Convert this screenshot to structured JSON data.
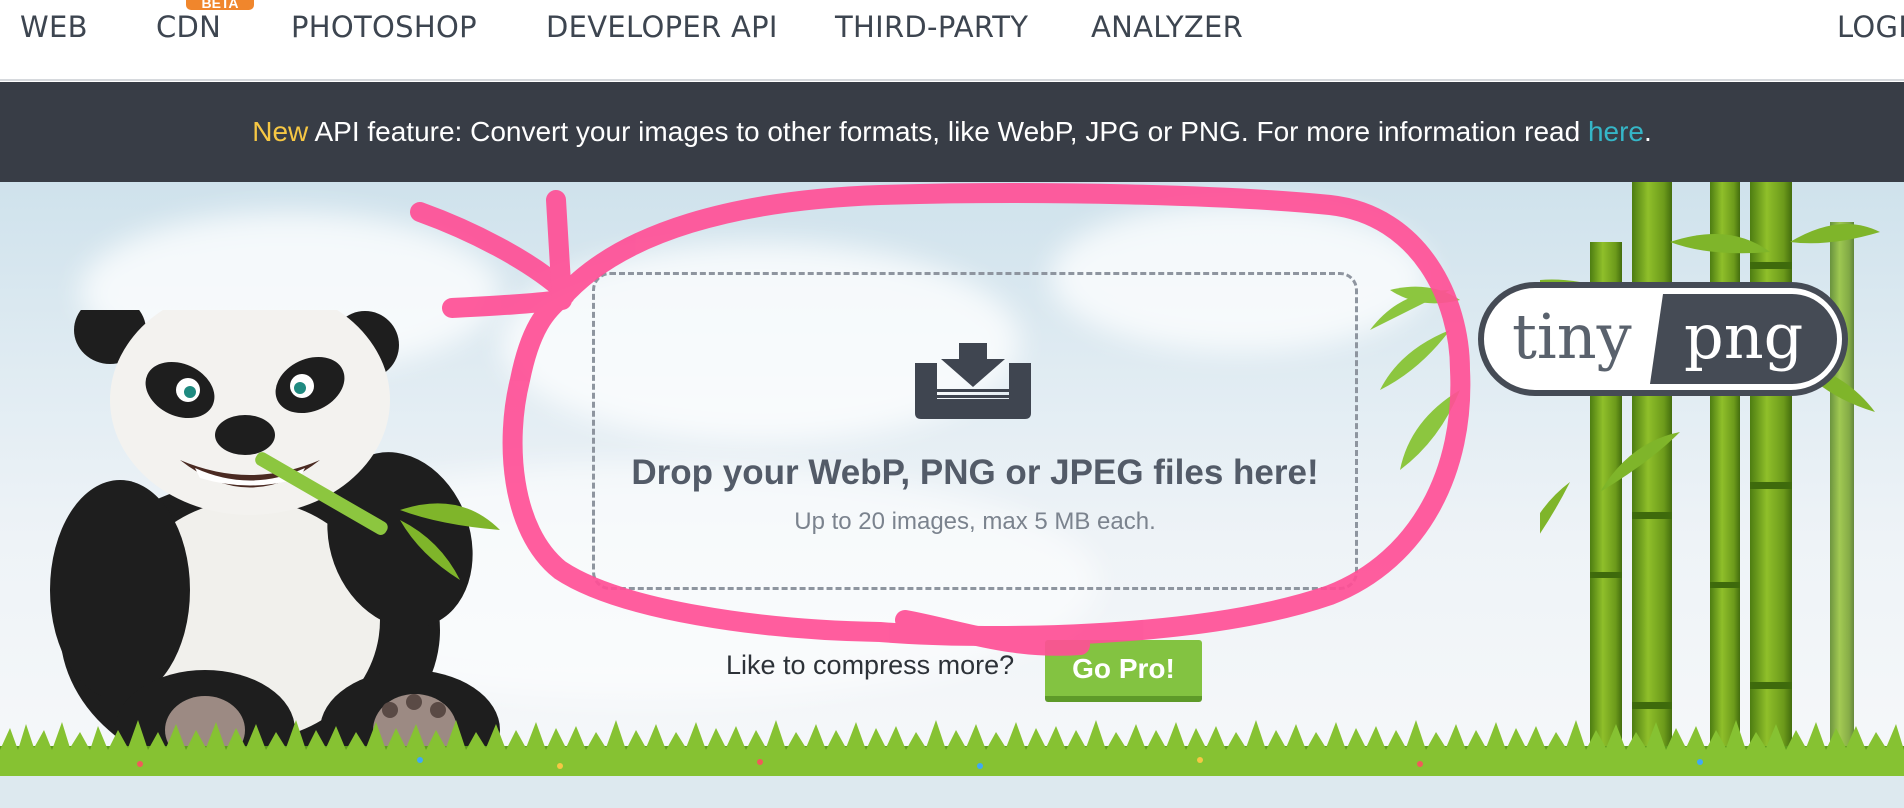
{
  "nav": {
    "items": [
      {
        "label": "WEB"
      },
      {
        "label": "CDN",
        "badge": "BETA"
      },
      {
        "label": "PHOTOSHOP"
      },
      {
        "label": "DEVELOPER API"
      },
      {
        "label": "THIRD-PARTY"
      },
      {
        "label": "ANALYZER"
      }
    ],
    "login": "LOGI"
  },
  "announcement": {
    "new": "New",
    "text": " API feature: Convert your images to other formats, like WebP, JPG or PNG. For more information read ",
    "link": "here",
    "end": "."
  },
  "dropzone": {
    "title": "Drop your WebP, PNG or JPEG files here!",
    "subtitle": "Up to 20 images, max 5 MB each.",
    "icon": "download-tray-icon"
  },
  "promo": {
    "text": "Like to compress more?",
    "button": "Go Pro!"
  },
  "logo": {
    "part1": "tiny",
    "part2": "png"
  },
  "colors": {
    "nav_text": "#3d4550",
    "badge": "#f0862c",
    "announce_bg": "#383d46",
    "announce_new": "#f6c744",
    "announce_link": "#35b6c7",
    "go_pro": "#83c341",
    "annotation_stroke": "#ff4f96",
    "logo_dark": "#454b55"
  }
}
